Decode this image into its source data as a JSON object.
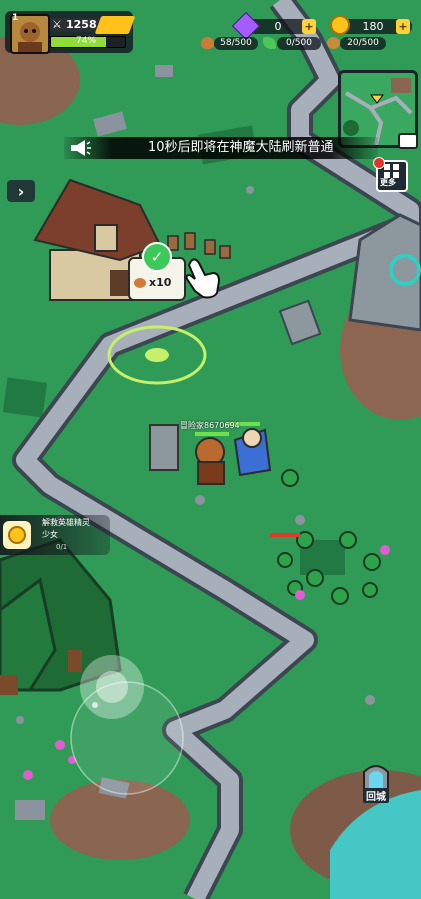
{
  "player": {
    "level": "1",
    "power": "1258",
    "exp_percent": "74%",
    "exp_fraction": 0.74
  },
  "currencies": {
    "gems": "0",
    "gold": "180"
  },
  "resources": {
    "meat": "58/500",
    "herb": "0/500",
    "wood": "20/500"
  },
  "announcement": "10秒后即将在神魔大陆刷新普通",
  "more_button": {
    "label": "更多"
  },
  "building": {
    "reward_amount": "x10"
  },
  "hero": {
    "name": "冒险家8670694"
  },
  "quest": {
    "title": "解救英雄精灵",
    "subtitle": "少女",
    "progress": "0/1"
  },
  "return_city": {
    "label": "回城"
  },
  "colors": {
    "grass": "#2f9b57",
    "road": "#9aa3ad",
    "road_edge": "#3b4650",
    "panel_dark": "#141c23",
    "exp_green": "#8fdc3a",
    "gem_purple": "#a45bff",
    "gold": "#ffc21a"
  },
  "icons": {
    "avatar": "hero-portrait-icon",
    "power": "crossed-swords-icon",
    "gem": "gem-icon",
    "gold": "gold-coin-icon",
    "add": "plus-icon",
    "meat": "meat-icon",
    "herb": "herb-icon",
    "wood": "wood-icon",
    "megaphone": "megaphone-icon",
    "expand": "chevron-right-icon",
    "check": "checkmark-icon",
    "quest": "coin-quest-icon",
    "portal": "portal-gate-icon"
  }
}
